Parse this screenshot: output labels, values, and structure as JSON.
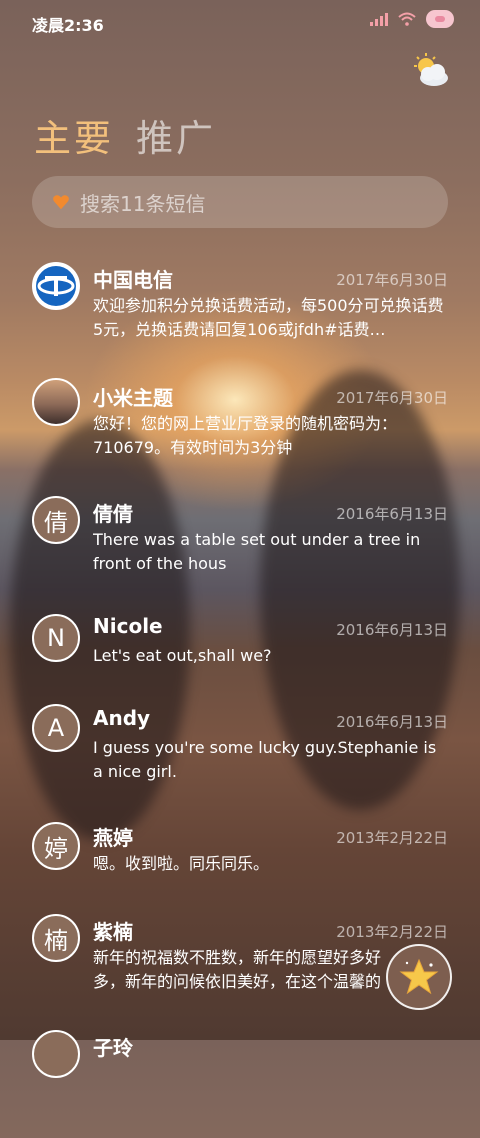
{
  "status_bar": {
    "time": "凌晨2:36"
  },
  "tabs": [
    {
      "label": "主要",
      "active": true
    },
    {
      "label": "推广",
      "active": false
    }
  ],
  "search": {
    "placeholder": "搜索11条短信"
  },
  "messages": [
    {
      "sender": "中国电信",
      "date": "2017年6月30日",
      "preview": "欢迎参加积分兑换话费活动，每500分可兑换话费5元，兑换话费请回复106或jfdh#话费…",
      "avatar": "china-telecom-logo"
    },
    {
      "sender": "小米主题",
      "date": "2017年6月30日",
      "preview": "您好！您的网上营业厅登录的随机密码为：710679。有效时间为3分钟",
      "avatar": "photo"
    },
    {
      "sender": "倩倩",
      "date": "2016年6月13日",
      "preview": "There was a table set out under a tree in front of the hous",
      "avatar_letter": "倩"
    },
    {
      "sender": "Nicole",
      "date": "2016年6月13日",
      "preview": "Let's eat out,shall we?",
      "avatar_letter": "N"
    },
    {
      "sender": "Andy",
      "date": "2016年6月13日",
      "preview": "I guess you're some lucky guy.Stephanie is a nice girl.",
      "avatar_letter": "A"
    },
    {
      "sender": "燕婷",
      "date": "2013年2月22日",
      "preview": "嗯。收到啦。同乐同乐。",
      "avatar_letter": "婷"
    },
    {
      "sender": "紫楠",
      "date": "2013年2月22日",
      "preview": "新年的祝福数不胜数，新年的愿望好多好多，新年的问候依旧美好，在这个温馨的时刻",
      "avatar_letter": "楠"
    },
    {
      "sender": "子玲",
      "date": "",
      "preview": "",
      "avatar_letter": ""
    }
  ],
  "colors": {
    "accent": "#f3c07c",
    "heart": "#f28a2e"
  },
  "icons": {
    "weather": "partly-cloudy-icon",
    "fab": "star-compose-icon"
  }
}
